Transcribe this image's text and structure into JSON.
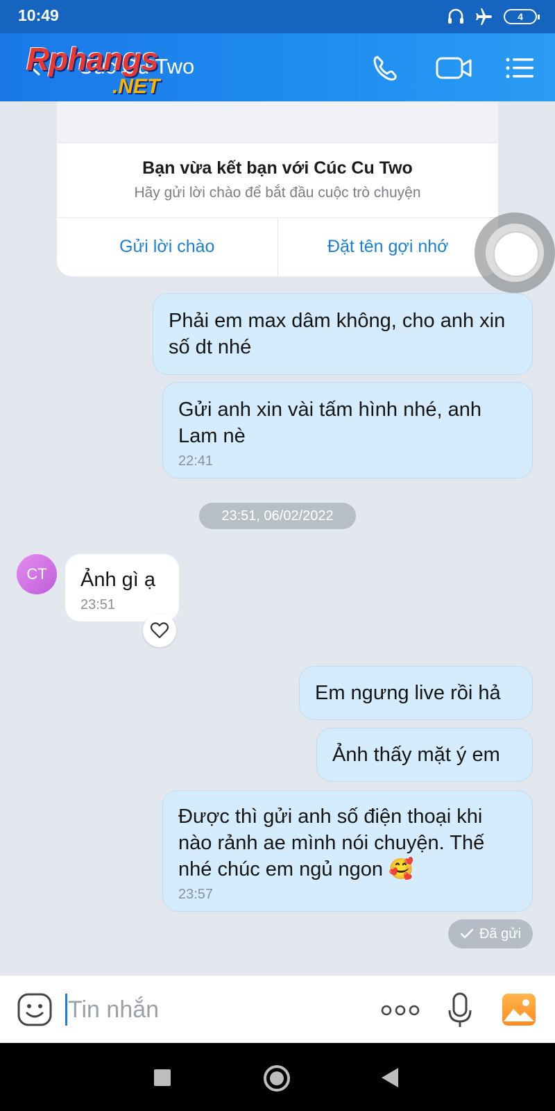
{
  "status_bar": {
    "time": "10:49",
    "battery": "4"
  },
  "header": {
    "contact_name": "Cúc Cu Two",
    "watermark_top": "Rphangs",
    "watermark_bottom": ".NET"
  },
  "friend_card": {
    "title": "Bạn vừa kết bạn với Cúc Cu Two",
    "subtitle": "Hãy gửi lời chào để bắt đầu cuộc trò chuyện",
    "action_greet": "Gửi lời chào",
    "action_nickname": "Đặt tên gợi nhớ"
  },
  "messages": {
    "m1": {
      "text": "Phải em max dâm không,  cho anh xin số dt nhé"
    },
    "m2": {
      "text": "Gửi anh xin vài tấm hình nhé,  anh Lam nè",
      "time": "22:41"
    },
    "date_separator": "23:51, 06/02/2022",
    "incoming": {
      "avatar": "CT",
      "text": "Ảnh gì ạ",
      "time": "23:51"
    },
    "m3": {
      "text": "Em ngưng live rồi hả"
    },
    "m4": {
      "text": "Ảnh thấy mặt ý em"
    },
    "m5": {
      "text": "Được thì gửi anh số điện thoại khi nào rảnh ae mình nói chuyện. Thế nhé chúc em ngủ ngon 🥰",
      "time": "23:57"
    },
    "sent_status": "Đã gửi"
  },
  "input_bar": {
    "placeholder": "Tin nhắn"
  },
  "colors": {
    "header": "#1e8cf0",
    "outgoing_bubble": "#d4ecfb",
    "background": "#e3e8ef",
    "accent": "#1a7fd6"
  },
  "icons": [
    "headset-icon",
    "airplane-icon",
    "battery-icon",
    "back-arrow-icon",
    "phone-icon",
    "video-call-icon",
    "menu-icon",
    "heart-icon",
    "check-icon",
    "sticker-icon",
    "more-icon",
    "microphone-icon",
    "image-icon"
  ]
}
